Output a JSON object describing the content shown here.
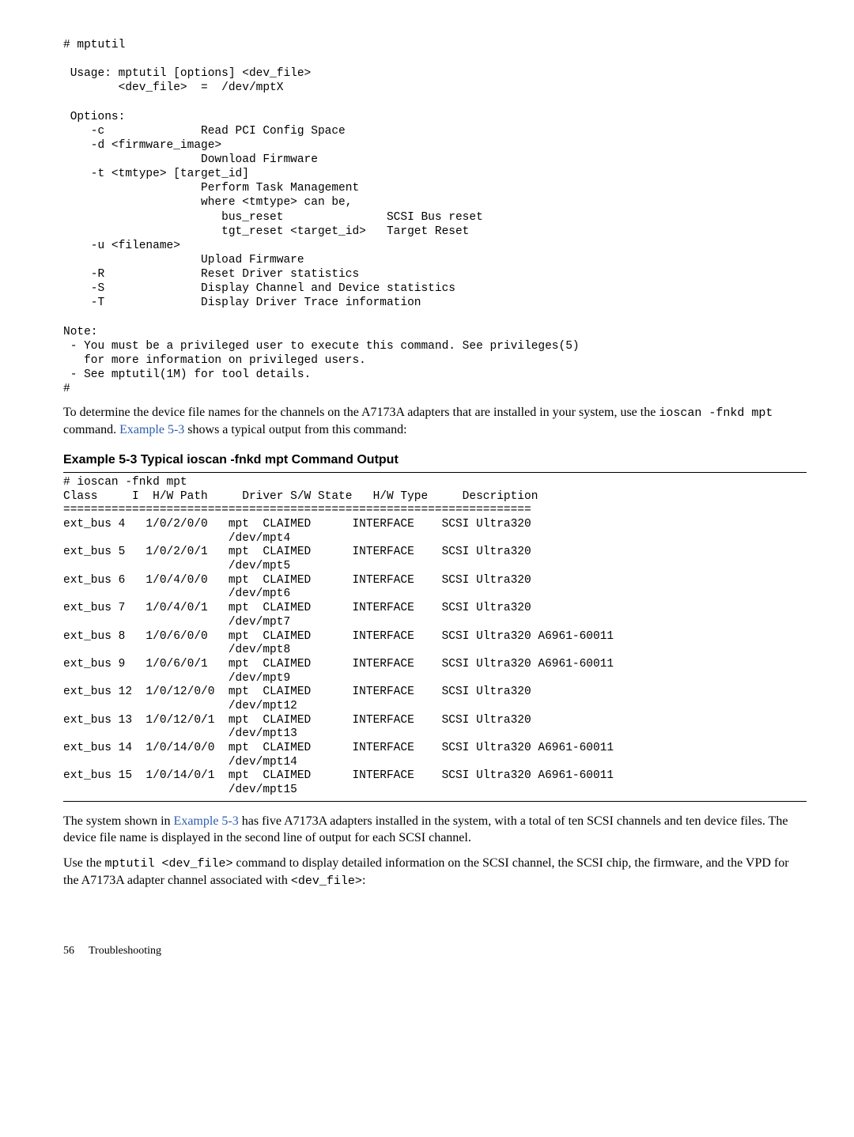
{
  "cmd_prompt": "# mptutil",
  "usage_block": [
    "",
    " Usage: mptutil [options] <dev_file>",
    "        <dev_file>  =  /dev/mptX",
    "",
    " Options:",
    "    -c              Read PCI Config Space",
    "    -d <firmware_image>",
    "                    Download Firmware",
    "    -t <tmtype> [target_id]",
    "                    Perform Task Management",
    "                    where <tmtype> can be,",
    "                       bus_reset               SCSI Bus reset",
    "                       tgt_reset <target_id>   Target Reset",
    "    -u <filename>",
    "                    Upload Firmware",
    "    -R              Reset Driver statistics",
    "    -S              Display Channel and Device statistics",
    "    -T              Display Driver Trace information",
    "",
    "Note:",
    " - You must be a privileged user to execute this command. See privileges(5)",
    "   for more information on privileged users.",
    " - See mptutil(1M) for tool details.",
    "#"
  ],
  "para1_pre": "To determine the device file names for the channels on the A7173A adapters that are installed in your system, use the ",
  "para1_cmd": "ioscan -fnkd mpt",
  "para1_mid": " command. ",
  "para1_link": "Example 5-3",
  "para1_post": " shows a typical output from this command:",
  "example_heading": "Example 5-3  Typical ioscan -fnkd mpt Command Output",
  "ioscan_cmd": "# ioscan -fnkd mpt",
  "ioscan_header": "Class     I  H/W Path     Driver S/W State   H/W Type     Description",
  "ioscan_divider": "====================================================================",
  "rows": [
    {
      "class": "ext_bus",
      "i": "4",
      "hw": "1/0/2/0/0",
      "drv": "mpt  CLAIMED",
      "type": "INTERFACE",
      "desc": "SCSI Ultra320",
      "dev": "/dev/mpt4"
    },
    {
      "class": "ext_bus",
      "i": "5",
      "hw": "1/0/2/0/1",
      "drv": "mpt  CLAIMED",
      "type": "INTERFACE",
      "desc": "SCSI Ultra320",
      "dev": "/dev/mpt5"
    },
    {
      "class": "ext_bus",
      "i": "6",
      "hw": "1/0/4/0/0",
      "drv": "mpt  CLAIMED",
      "type": "INTERFACE",
      "desc": "SCSI Ultra320",
      "dev": "/dev/mpt6"
    },
    {
      "class": "ext_bus",
      "i": "7",
      "hw": "1/0/4/0/1",
      "drv": "mpt  CLAIMED",
      "type": "INTERFACE",
      "desc": "SCSI Ultra320",
      "dev": "/dev/mpt7"
    },
    {
      "class": "ext_bus",
      "i": "8",
      "hw": "1/0/6/0/0",
      "drv": "mpt  CLAIMED",
      "type": "INTERFACE",
      "desc": "SCSI Ultra320 A6961-60011",
      "dev": "/dev/mpt8"
    },
    {
      "class": "ext_bus",
      "i": "9",
      "hw": "1/0/6/0/1",
      "drv": "mpt  CLAIMED",
      "type": "INTERFACE",
      "desc": "SCSI Ultra320 A6961-60011",
      "dev": "/dev/mpt9"
    },
    {
      "class": "ext_bus",
      "i": "12",
      "hw": "1/0/12/0/0",
      "drv": "mpt  CLAIMED",
      "type": "INTERFACE",
      "desc": "SCSI Ultra320",
      "dev": "/dev/mpt12"
    },
    {
      "class": "ext_bus",
      "i": "13",
      "hw": "1/0/12/0/1",
      "drv": "mpt  CLAIMED",
      "type": "INTERFACE",
      "desc": "SCSI Ultra320",
      "dev": "/dev/mpt13"
    },
    {
      "class": "ext_bus",
      "i": "14",
      "hw": "1/0/14/0/0",
      "drv": "mpt  CLAIMED",
      "type": "INTERFACE",
      "desc": "SCSI Ultra320 A6961-60011",
      "dev": "/dev/mpt14"
    },
    {
      "class": "ext_bus",
      "i": "15",
      "hw": "1/0/14/0/1",
      "drv": "mpt  CLAIMED",
      "type": "INTERFACE",
      "desc": "SCSI Ultra320 A6961-60011",
      "dev": "/dev/mpt15"
    }
  ],
  "para2_pre": "The system shown in ",
  "para2_link": "Example 5-3",
  "para2_post": " has five A7173A adapters installed in the system, with a total of ten SCSI channels and ten device files. The device file name is displayed in the second line of output for each SCSI channel.",
  "para3_pre": "Use the ",
  "para3_cmd1": "mptutil <dev_file>",
  "para3_mid": " command to display detailed information on the SCSI channel, the SCSI chip, the firmware, and the VPD for the A7173A adapter channel associated with ",
  "para3_cmd2": "<dev_file>",
  "para3_post": ":",
  "footer_page": "56",
  "footer_title": "Troubleshooting"
}
